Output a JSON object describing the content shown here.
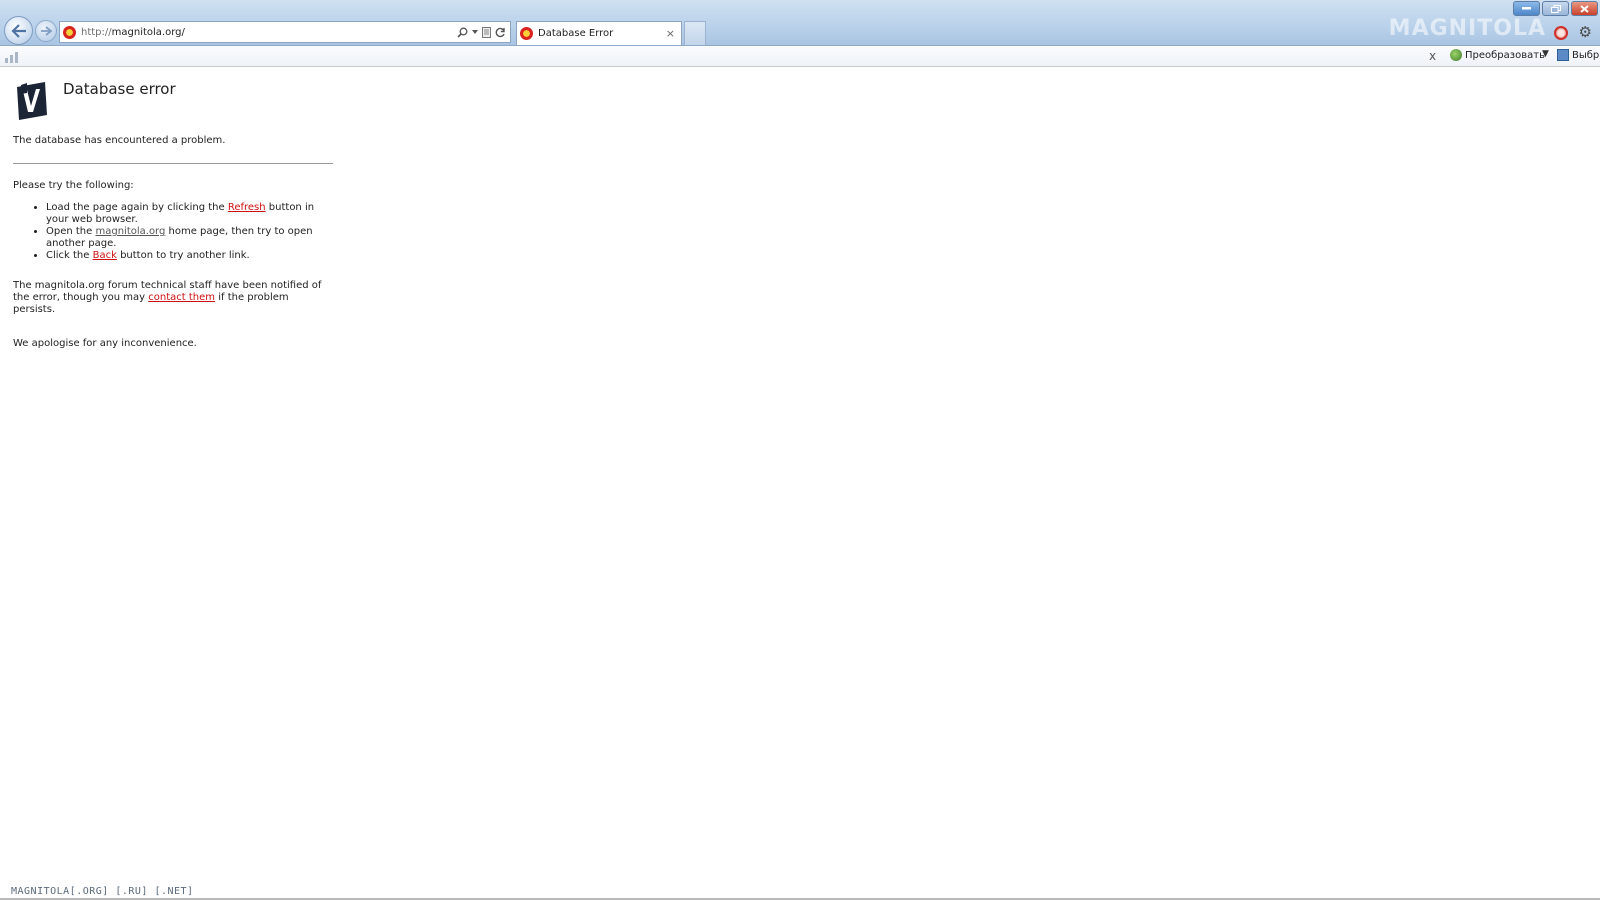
{
  "browser": {
    "address_prefix": "http://",
    "address_host": "magnitola.org/",
    "tab_title": "Database Error",
    "tab_close": "×",
    "watermark": "MAGNITOLA"
  },
  "command_bar": {
    "close_label": "x",
    "translate_label": "Преобразовать",
    "dropdown_label": "▼",
    "select_label": "Выбр"
  },
  "page": {
    "title": "Database error",
    "intro": "The database has encountered a problem.",
    "try_heading": "Please try the following:",
    "suggestions": [
      {
        "before": "Load the page again by clicking the ",
        "link": "Refresh",
        "after": " button in your web browser."
      },
      {
        "before": "Open the ",
        "link": "magnitola.org",
        "after": " home page, then try to open another page."
      },
      {
        "before": "Click the ",
        "link": "Back",
        "after": " button to try another link."
      }
    ],
    "notice": {
      "before": "The magnitola.org forum technical staff have been notified of the error, though you may ",
      "link": "contact them",
      "after": " if the problem persists."
    },
    "apology": "We apologise for any inconvenience."
  },
  "footer": "MAGNITOLA[.ORG] [.RU] [.NET]",
  "colors": {
    "link_red": "#d01010",
    "titlebar": "#b9d1ea"
  },
  "icons": [
    "back-icon",
    "forward-icon",
    "site-favicon",
    "search-icon",
    "compat-icon",
    "refresh-icon",
    "close-icon",
    "gear-icon",
    "home-icon",
    "feed-icon",
    "translate-icon",
    "select-icon",
    "logo-icon"
  ]
}
